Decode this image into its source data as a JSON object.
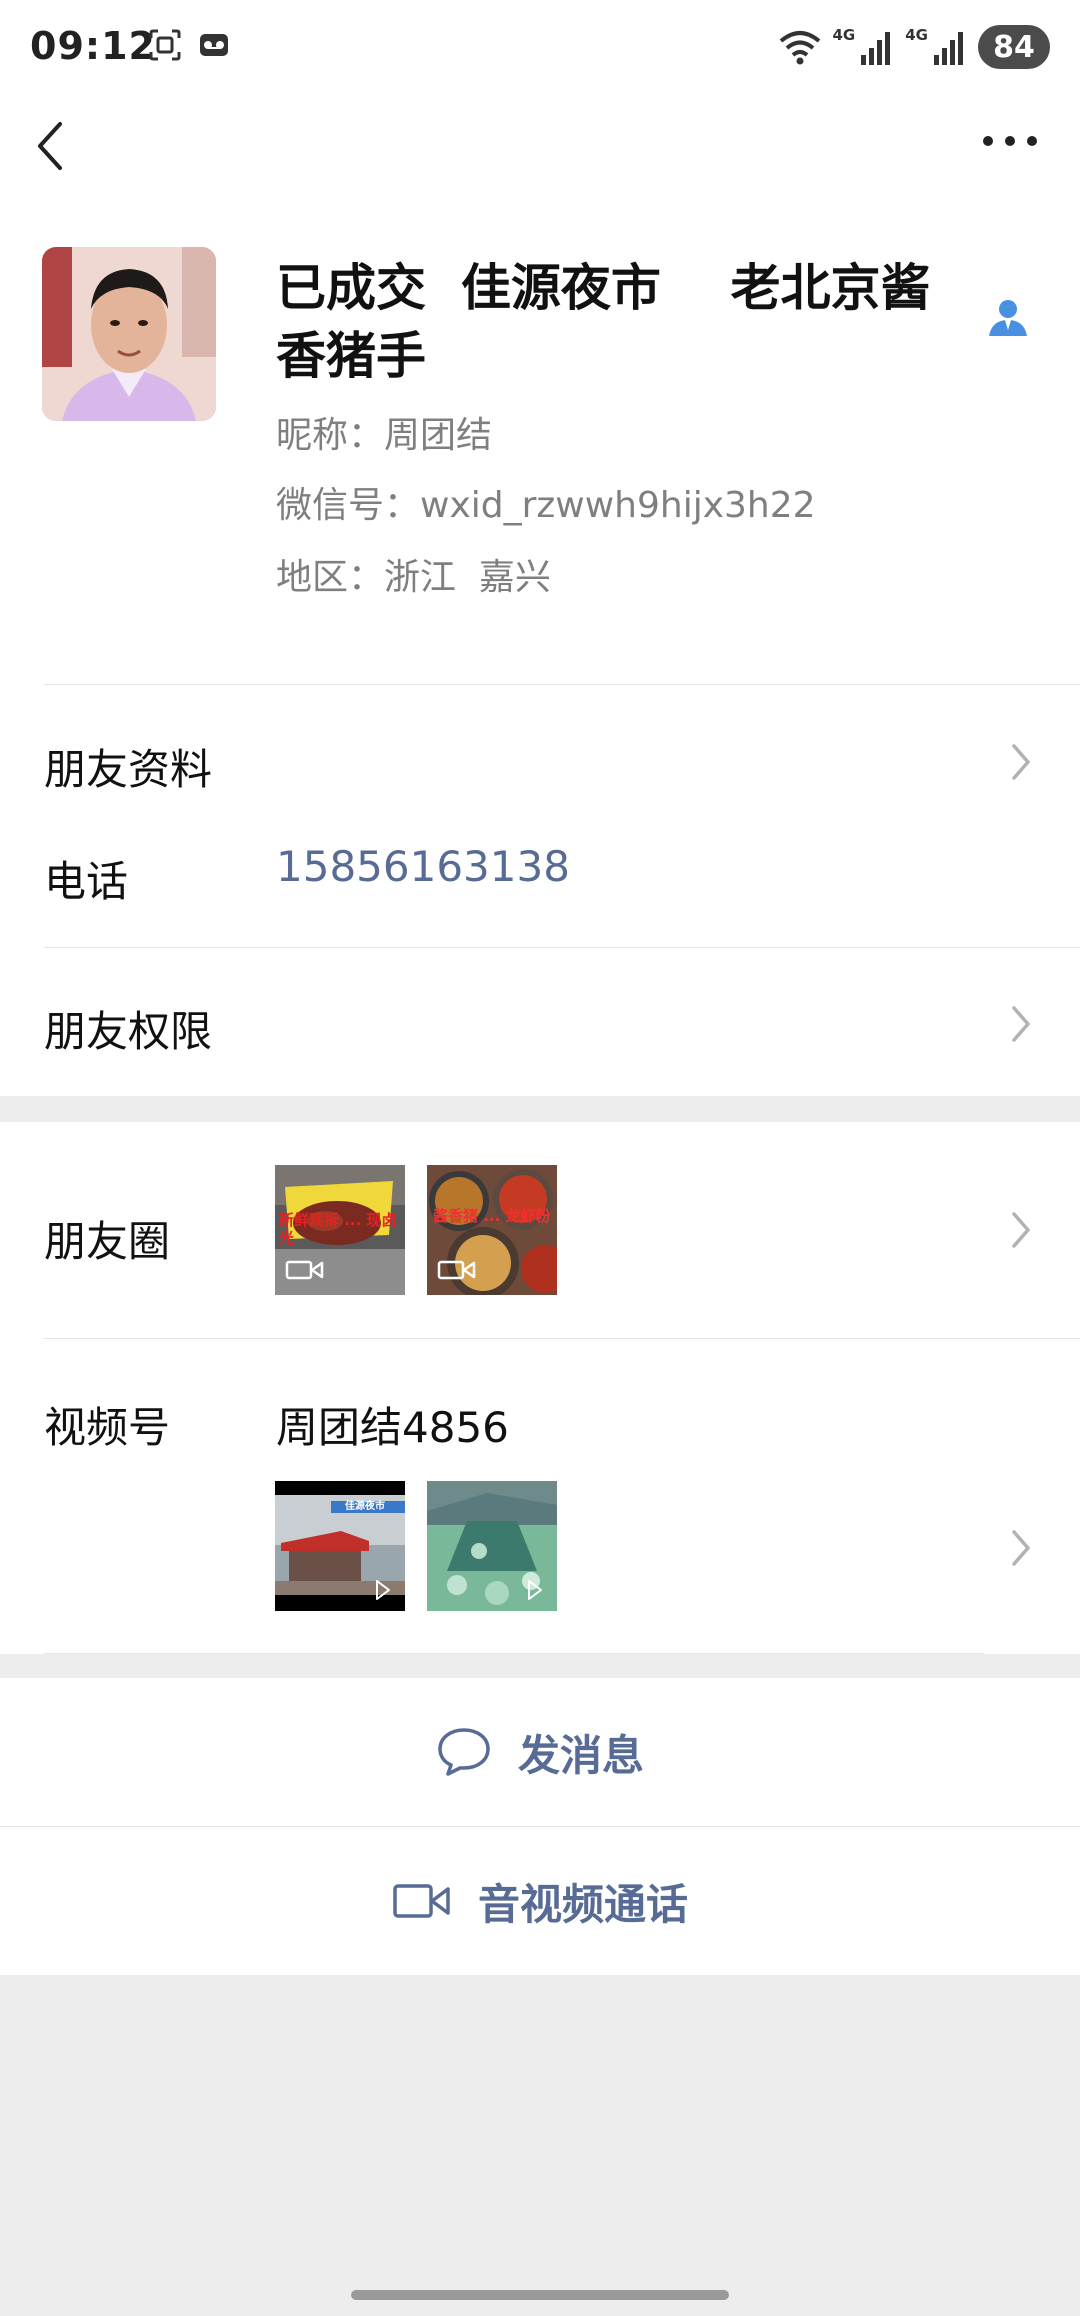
{
  "status_bar": {
    "time": "09:12",
    "net_1": "4G",
    "net_2": "4G",
    "battery": "84"
  },
  "profile": {
    "name": "已成交  佳源夜市    老北京酱香猪手",
    "nickname": "昵称：周团结",
    "wechat_id": "微信号：wxid_rzwwh9hijx3h22",
    "region": "地区：浙江  嘉兴"
  },
  "rows": {
    "friend_info_label": "朋友资料",
    "phone_label": "电话",
    "phone_value": "15856163138",
    "permissions_label": "朋友权限",
    "moments_label": "朋友圈",
    "channels_label": "视频号",
    "channels_name": "周团结4856"
  },
  "moments_thumbs": [
    {
      "text": "新鲜现拆 ... 现卤光",
      "icon": "video-camera-icon"
    },
    {
      "text": "酱香猪 ... 龙虾粉",
      "icon": "video-camera-icon"
    }
  ],
  "channel_thumbs": [
    {
      "text": "佳源夜市",
      "icon": "play-icon"
    },
    {
      "text": "",
      "icon": "play-icon"
    }
  ],
  "actions": {
    "send_message": "发消息",
    "video_call": "音视频通话"
  },
  "colors": {
    "link": "#576b95",
    "background": "#ededed",
    "card": "#ffffff"
  }
}
